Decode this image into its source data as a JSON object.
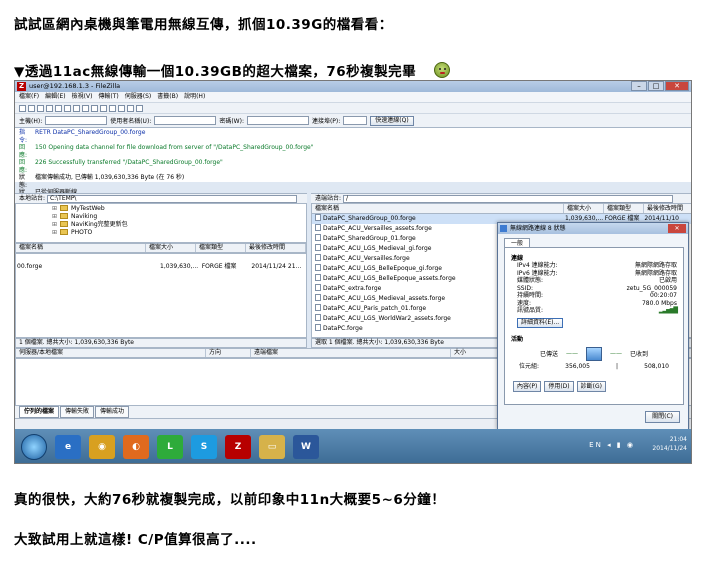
{
  "article": {
    "line1": "試試區網內桌機與筆電用無線互傳，抓個10.39G的檔看看：",
    "line2": "▼透過11ac無線傳輸一個10.39GB的超大檔案，76秒複製完畢",
    "line3": "真的很快，大約76秒就複製完成，以前印象中11n大概要5~6分鐘！",
    "line4": "大致試用上就這樣! C/P值算很高了...."
  },
  "filezilla": {
    "title": "user@192.168.1.3 - FileZilla",
    "menu": [
      "檔案(F)",
      "編輯(E)",
      "檢視(V)",
      "傳輸(T)",
      "伺服器(S)",
      "書籤(B)",
      "說明(H)"
    ],
    "quickconnect": {
      "host_label": "主機(H):",
      "user_label": "使用者名稱(U):",
      "pass_label": "密碼(W):",
      "port_label": "連接埠(P):",
      "button": "快速連線(Q)"
    },
    "log": [
      {
        "key": "指令:",
        "text": "RETR DataPC_SharedGroup_00.forge",
        "tone": "blue"
      },
      {
        "key": "回應:",
        "text": "150 Opening data channel for file download from server of \"/DataPC_SharedGroup_00.forge\"",
        "tone": "green"
      },
      {
        "key": "回應:",
        "text": "226 Successfully transferred \"/DataPC_SharedGroup_00.forge\"",
        "tone": "green"
      },
      {
        "key": "狀態:",
        "text": "檔案傳輸成功, 已傳輸 1,039,630,336 Byte (在 76 秒)",
        "tone": "normal"
      },
      {
        "key": "狀態:",
        "text": "已從伺服器斷線",
        "tone": "normal"
      }
    ],
    "local": {
      "path_label": "本地站台:",
      "path": "C:\\TEMP\\",
      "tree": [
        "MyTestWeb",
        "Naviking",
        "NaviKing完整更新包",
        "PHOTO"
      ],
      "columns": [
        "檔案名稱",
        "檔案大小",
        "檔案類型",
        "最後修改時間"
      ],
      "files": [
        {
          "name": "00.forge",
          "size": "1,039,630,...",
          "type": "FORGE 檔案",
          "modified": "2014/11/24 21..."
        }
      ],
      "status": "1 個檔案. 總共大小: 1,039,630,336 Byte"
    },
    "remote": {
      "path_label": "遠端站台:",
      "path": "/",
      "columns": [
        "檔案名稱",
        "檔案大小",
        "檔案類型",
        "最後修改時間"
      ],
      "files": [
        {
          "name": "DataPC_SharedGroup_00.forge",
          "size": "1,039,630,...",
          "type": "FORGE 檔案",
          "modified": "2014/11/10"
        },
        {
          "name": "DataPC_ACU_Versailles_assets.forge",
          "size": "",
          "type": "",
          "modified": ""
        },
        {
          "name": "DataPC_SharedGroup_01.forge",
          "size": "",
          "type": "",
          "modified": ""
        },
        {
          "name": "DataPC_ACU_LGS_Medieval_gi.forge",
          "size": "",
          "type": "",
          "modified": ""
        },
        {
          "name": "DataPC_ACU_Versailles.forge",
          "size": "",
          "type": "",
          "modified": ""
        },
        {
          "name": "DataPC_ACU_LGS_BelleEpoque_gi.forge",
          "size": "",
          "type": "",
          "modified": ""
        },
        {
          "name": "DataPC_ACU_LGS_BelleEpoque_assets.forge",
          "size": "",
          "type": "",
          "modified": ""
        },
        {
          "name": "DataPC_extra.forge",
          "size": "",
          "type": "",
          "modified": ""
        },
        {
          "name": "DataPC_ACU_LGS_Medieval_assets.forge",
          "size": "",
          "type": "",
          "modified": ""
        },
        {
          "name": "DataPC_ACU_Paris_patch_01.forge",
          "size": "",
          "type": "",
          "modified": ""
        },
        {
          "name": "DataPC_ACU_LGS_WorldWar2_assets.forge",
          "size": "",
          "type": "",
          "modified": ""
        },
        {
          "name": "DataPC.forge",
          "size": "",
          "type": "",
          "modified": ""
        }
      ],
      "status": "選取 1 個檔案. 總共大小: 1,039,630,336 Byte"
    },
    "queue": {
      "columns": [
        "伺服器/本地檔案",
        "方向",
        "遠端檔案",
        "大小",
        "優先",
        "狀態"
      ],
      "tabs": [
        "佇列的檔案",
        "傳輸失敗",
        "傳輸成功"
      ]
    }
  },
  "dialog": {
    "title": "無線網路連線 8 狀態",
    "tab": "一般",
    "section_connection": "連線",
    "rows": [
      {
        "k": "IPv4 連線能力:",
        "v": "無網際網路存取"
      },
      {
        "k": "IPv6 連線能力:",
        "v": "無網際網路存取"
      },
      {
        "k": "媒體狀態:",
        "v": "已啟用"
      },
      {
        "k": "SSID:",
        "v": "zetu_5G_000059"
      },
      {
        "k": "持續時間:",
        "v": "00:20:07"
      },
      {
        "k": "速度:",
        "v": "780.0 Mbps"
      }
    ],
    "signal_label": "訊號品質:",
    "details_button": "詳細資料(E)...",
    "section_activity": "活動",
    "sent_label": "已傳送",
    "received_label": "已收到",
    "bytes_label": "位元組:",
    "sent_bytes": "356,005",
    "received_bytes": "508,010",
    "buttons": [
      "內容(P)",
      "停用(D)",
      "診斷(G)"
    ],
    "close": "關閉(C)"
  },
  "taskbar": {
    "lang": "EN",
    "time": "21:04",
    "date": "2014/11/24",
    "apps": [
      "ie",
      "chrome",
      "firefox",
      "line",
      "skype",
      "filezilla",
      "explorer",
      "word"
    ]
  },
  "colors": {
    "filezilla_logo": "#b70000",
    "taskbar": "#4a7aa4",
    "log_command": "#0b2fa8",
    "log_response": "#0a7a2a"
  }
}
